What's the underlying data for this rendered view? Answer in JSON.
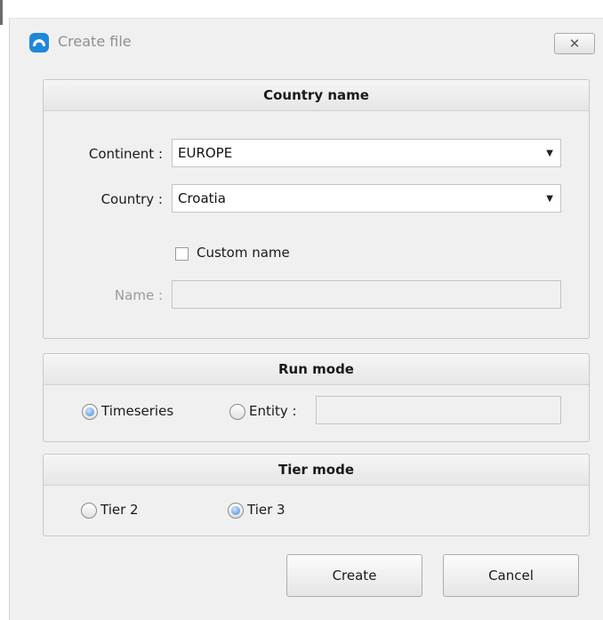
{
  "window": {
    "title": "Create file"
  },
  "country_group": {
    "header": "Country name",
    "continent_label": "Continent :",
    "continent_value": "EUROPE",
    "country_label": "Country :",
    "country_value": "Croatia",
    "custom_name_label": "Custom name",
    "custom_name_checked": false,
    "name_label": "Name :",
    "name_value": ""
  },
  "run_mode": {
    "header": "Run mode",
    "timeseries_label": "Timeseries",
    "entity_label": "Entity :",
    "selected": "Timeseries",
    "entity_value": ""
  },
  "tier_mode": {
    "header": "Tier mode",
    "tier2_label": "Tier 2",
    "tier3_label": "Tier 3",
    "selected": "Tier 3"
  },
  "buttons": {
    "create": "Create",
    "cancel": "Cancel"
  },
  "icons": {
    "app": "cloud-icon",
    "close": "close-icon",
    "dropdown": "chevron-down-icon"
  },
  "colors": {
    "accent": "#1e88d8",
    "radio_selected": "#3f86d4"
  }
}
